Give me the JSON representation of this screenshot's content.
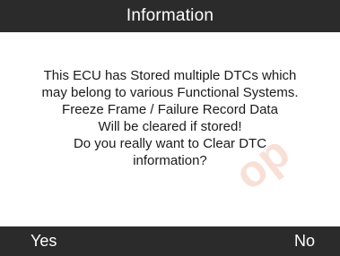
{
  "header": {
    "title": "Information"
  },
  "dialog": {
    "lines": [
      "This ECU has Stored multiple DTCs which",
      "may belong to various Functional Systems.",
      "Freeze Frame / Failure Record Data",
      "Will be cleared if stored!",
      "Do you really want to Clear DTC",
      "information?"
    ]
  },
  "softkeys": {
    "yes_label": "Yes",
    "no_label": "No"
  },
  "colors": {
    "bar_background": "#2b2b2b",
    "bar_text": "#ffffff",
    "body_background": "#ffffff",
    "body_text": "#1a1a1a"
  }
}
